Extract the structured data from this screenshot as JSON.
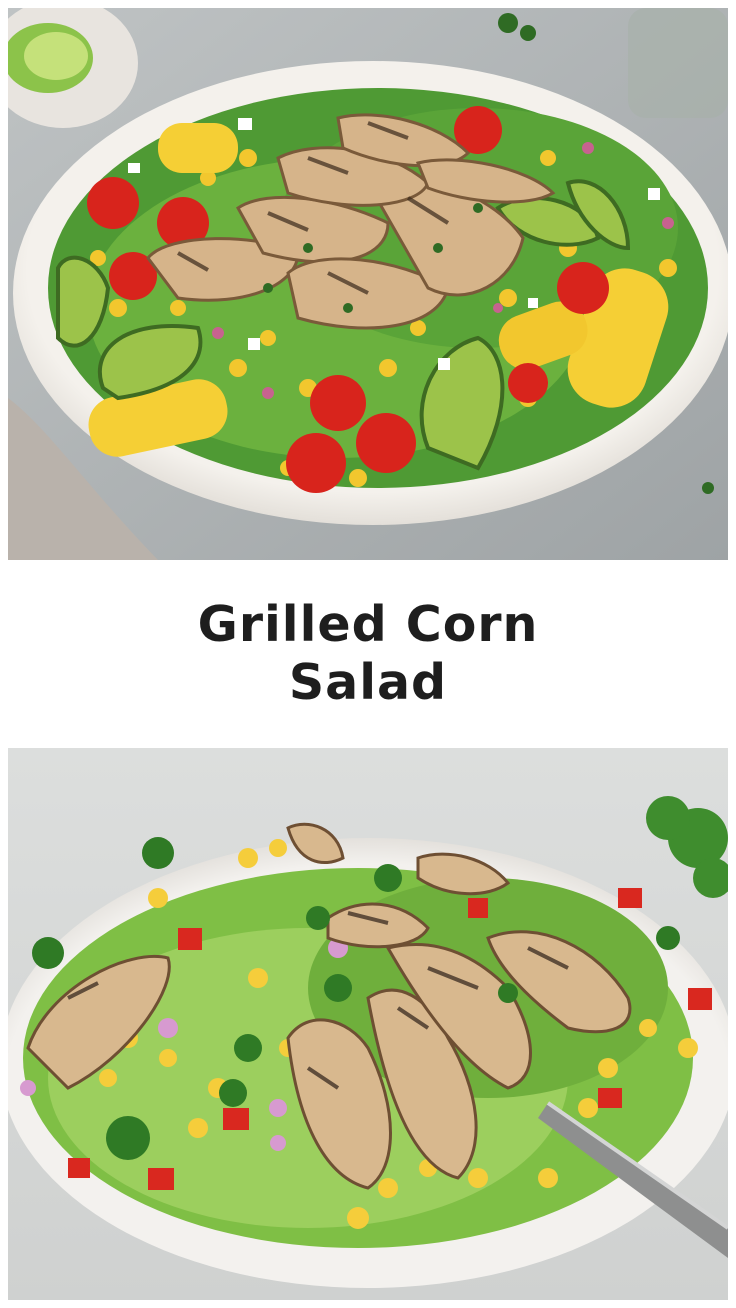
{
  "title": "Grilled Corn Salad",
  "images": [
    {
      "subject": "grilled-chicken-corn-salad-plate-overhead"
    },
    {
      "subject": "grilled-chicken-corn-salad-bowl-with-fork"
    }
  ],
  "colors": {
    "background": "#ffffff",
    "title_text": "#1e1e1e",
    "countertop": "#c9cccd",
    "plate": "#f2efea",
    "lettuce": "#4f9a34",
    "corn": "#f2c72e",
    "tomato": "#d8241c",
    "avocado": "#9cc34a",
    "chicken": "#d6b48a"
  }
}
